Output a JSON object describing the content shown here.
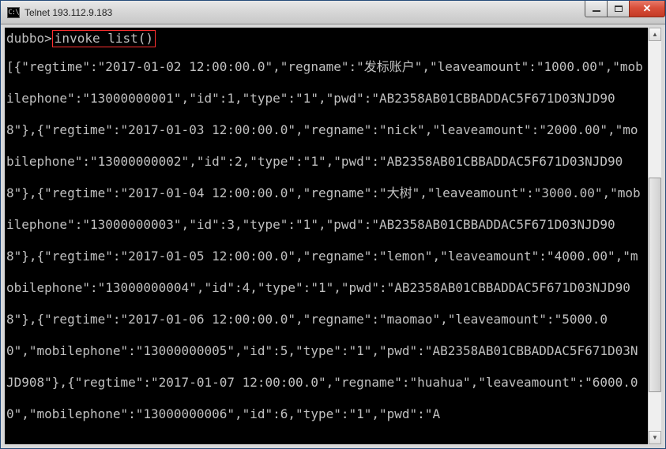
{
  "window": {
    "title": "Telnet 193.112.9.183",
    "icon_label": "C:\\"
  },
  "terminal": {
    "prompt": "dubbo>",
    "command": "invoke list()",
    "output": "[{\"regtime\":\"2017-01-02 12:00:00.0\",\"regname\":\"发标账户\",\"leaveamount\":\"1000.00\",\"mobilephone\":\"13000000001\",\"id\":1,\"type\":\"1\",\"pwd\":\"AB2358AB01CBBADDAC5F671D03NJD908\"},{\"regtime\":\"2017-01-03 12:00:00.0\",\"regname\":\"nick\",\"leaveamount\":\"2000.00\",\"mobilephone\":\"13000000002\",\"id\":2,\"type\":\"1\",\"pwd\":\"AB2358AB01CBBADDAC5F671D03NJD908\"},{\"regtime\":\"2017-01-04 12:00:00.0\",\"regname\":\"大树\",\"leaveamount\":\"3000.00\",\"mobilephone\":\"13000000003\",\"id\":3,\"type\":\"1\",\"pwd\":\"AB2358AB01CBBADDAC5F671D03NJD908\"},{\"regtime\":\"2017-01-05 12:00:00.0\",\"regname\":\"lemon\",\"leaveamount\":\"4000.00\",\"mobilephone\":\"13000000004\",\"id\":4,\"type\":\"1\",\"pwd\":\"AB2358AB01CBBADDAC5F671D03NJD908\"},{\"regtime\":\"2017-01-06 12:00:00.0\",\"regname\":\"maomao\",\"leaveamount\":\"5000.00\",\"mobilephone\":\"13000000005\",\"id\":5,\"type\":\"1\",\"pwd\":\"AB2358AB01CBBADDAC5F671D03NJD908\"},{\"regtime\":\"2017-01-07 12:00:00.0\",\"regname\":\"huahua\",\"leaveamount\":\"6000.00\",\"mobilephone\":\"13000000006\",\"id\":6,\"type\":\"1\",\"pwd\":\"A"
  }
}
